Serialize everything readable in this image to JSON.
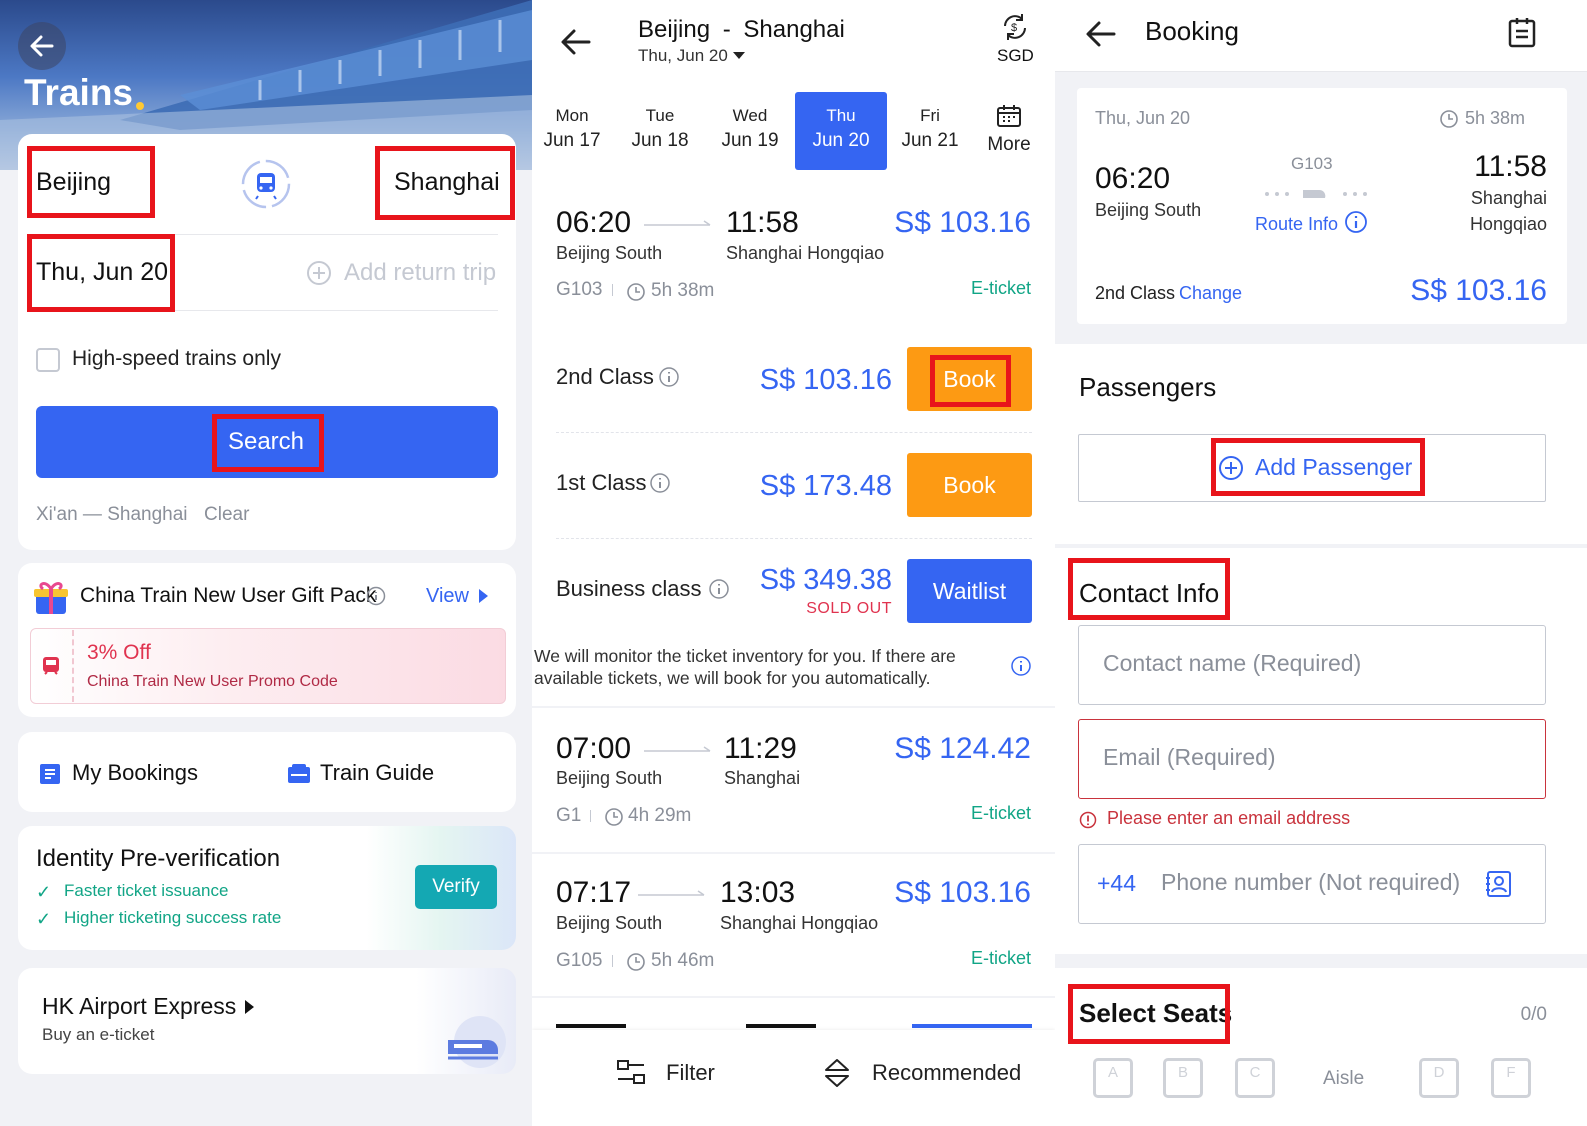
{
  "left": {
    "title": "Trains",
    "from": "Beijing",
    "to": "Shanghai",
    "date": "Thu, Jun 20",
    "add_return": "Add return trip",
    "highspeed_label": "High-speed trains only",
    "search_label": "Search",
    "history_route": "Xi'an — Shanghai",
    "clear_label": "Clear",
    "promo": {
      "title": "China Train New User Gift Pack",
      "view_label": "View",
      "discount": "3% Off",
      "code_text": "China Train New User Promo Code"
    },
    "my_bookings": "My Bookings",
    "train_guide": "Train Guide",
    "identity": {
      "title": "Identity Pre-verification",
      "benefit1": "Faster ticket issuance",
      "benefit2": "Higher ticketing success rate",
      "verify_label": "Verify"
    },
    "hk": {
      "title": "HK Airport Express",
      "subtitle": "Buy an e-ticket"
    }
  },
  "middle": {
    "route_from": "Beijing",
    "route_sep": "-",
    "route_to": "Shanghai",
    "date": "Thu, Jun 20",
    "currency": "SGD",
    "dates": [
      {
        "dow": "Mon",
        "date": "Jun 17"
      },
      {
        "dow": "Tue",
        "date": "Jun 18"
      },
      {
        "dow": "Wed",
        "date": "Jun 19"
      },
      {
        "dow": "Thu",
        "date": "Jun 20"
      },
      {
        "dow": "Fri",
        "date": "Jun 21"
      }
    ],
    "more_label": "More",
    "trains": [
      {
        "dep": "06:20",
        "arr": "11:58",
        "from": "Beijing South",
        "to": "Shanghai Hongqiao",
        "price": "S$ 103.16",
        "code": "G103",
        "duration": "5h 38m",
        "ticket": "E-ticket"
      },
      {
        "dep": "07:00",
        "arr": "11:29",
        "from": "Beijing South",
        "to": "Shanghai",
        "price": "S$ 124.42",
        "code": "G1",
        "duration": "4h 29m",
        "ticket": "E-ticket"
      },
      {
        "dep": "07:17",
        "arr": "13:03",
        "from": "Beijing South",
        "to": "Shanghai Hongqiao",
        "price": "S$ 103.16",
        "code": "G105",
        "duration": "5h 46m",
        "ticket": "E-ticket"
      }
    ],
    "classes": [
      {
        "name": "2nd Class",
        "price": "S$ 103.16",
        "action": "Book"
      },
      {
        "name": "1st Class",
        "price": "S$ 173.48",
        "action": "Book"
      },
      {
        "name": "Business class",
        "price": "S$ 349.38",
        "status": "SOLD OUT",
        "action": "Waitlist"
      }
    ],
    "monitor_note": "We will monitor the ticket inventory for you. If there are available tickets, we will book for you automatically.",
    "filter_label": "Filter",
    "sort_label": "Recommended"
  },
  "right": {
    "title": "Booking",
    "date": "Thu, Jun 20",
    "duration": "5h 38m",
    "dep": "06:20",
    "arr": "11:58",
    "train_code": "G103",
    "from": "Beijing South",
    "to_line1": "Shanghai",
    "to_line2": "Hongqiao",
    "route_info": "Route Info",
    "seat_class": "2nd Class",
    "change_label": "Change",
    "price": "S$ 103.16",
    "passengers_title": "Passengers",
    "add_passenger": "Add Passenger",
    "contact_title": "Contact Info",
    "contact_name_placeholder": "Contact name (Required)",
    "email_placeholder": "Email (Required)",
    "email_error": "Please enter an email address",
    "country_code": "+44",
    "phone_placeholder": "Phone number (Not required)",
    "seats_title": "Select Seats",
    "seats_count": "0/0",
    "seat_letters": [
      "A",
      "B",
      "C",
      "D",
      "F"
    ],
    "aisle_label": "Aisle"
  },
  "colors": {
    "accent": "#3565f2",
    "orange": "#fd9a13",
    "green": "#11a586",
    "red": "#e8141b",
    "teal": "#14a8b3"
  }
}
